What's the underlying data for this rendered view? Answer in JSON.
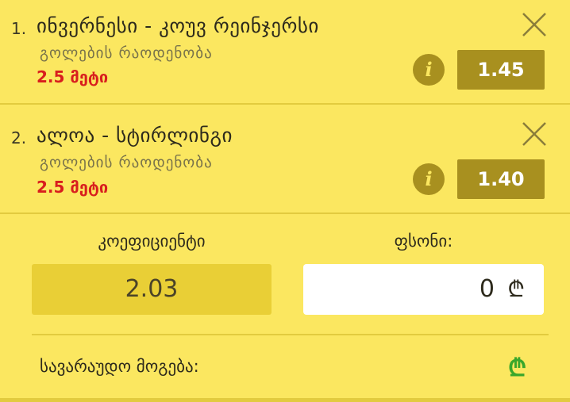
{
  "bets": [
    {
      "index": "1.",
      "match": "ინვერნესი - კოუვ რეინჯერსი",
      "market": "გოლების რაოდენობა",
      "pick": "2.5 მეტი",
      "odds": "1.45",
      "info_glyph": "i",
      "close_icon": "close-x-icon"
    },
    {
      "index": "2.",
      "match": "ალოა - სტირლინგი",
      "market": "გოლების რაოდენობა",
      "pick": "2.5 მეტი",
      "odds": "1.40",
      "info_glyph": "i",
      "close_icon": "close-x-icon"
    }
  ],
  "summary": {
    "coef_label": "კოეფიციენტი",
    "coef_value": "2.03",
    "stake_label": "ფსონი:",
    "stake_value": "0",
    "currency_symbol": "₾",
    "potential_win_label": "სავარაუდო მოგება:",
    "potential_win_currency": "₾"
  },
  "colors": {
    "background": "#fbe760",
    "accent_dark": "#a8901f",
    "pick_red": "#d81e1e",
    "win_green": "#3aa72b"
  }
}
